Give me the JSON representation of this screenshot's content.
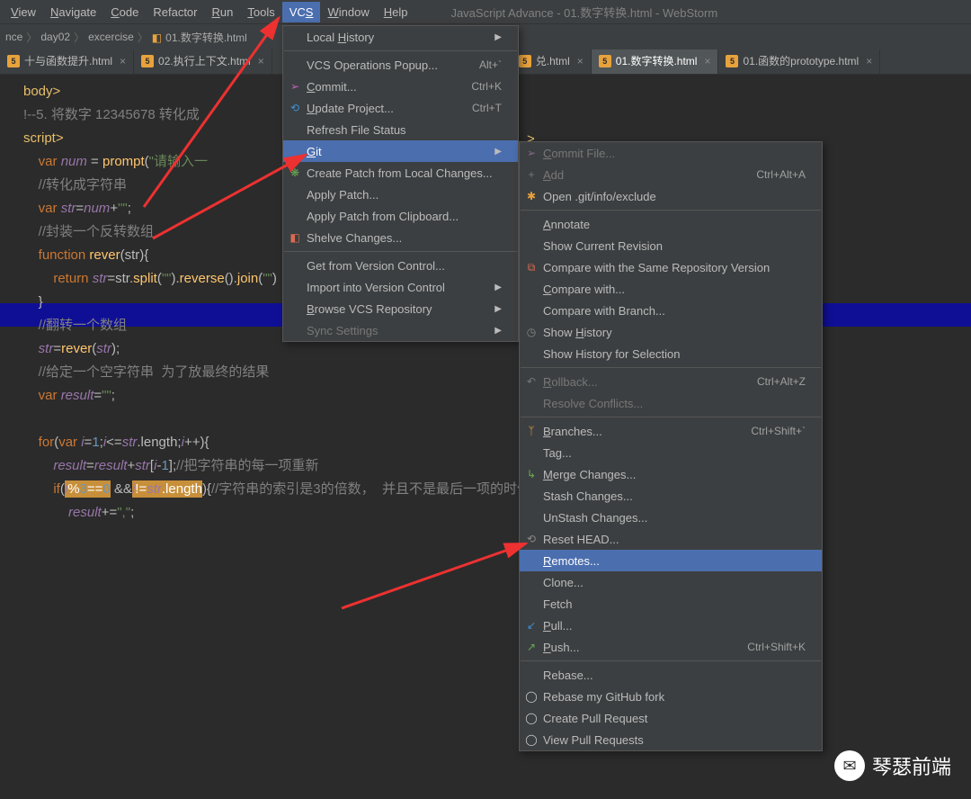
{
  "menubar": {
    "items": [
      "View",
      "Navigate",
      "Code",
      "Refactor",
      "Run",
      "Tools",
      "VCS",
      "Window",
      "Help"
    ],
    "underlines": [
      "V",
      "N",
      "C",
      "",
      "R",
      "T",
      "S",
      "W",
      "H"
    ],
    "title": "JavaScript Advance - 01.数字转换.html - WebStorm"
  },
  "breadcrumb": {
    "items": [
      "nce",
      "day02",
      "excercise",
      "01.数字转换.html"
    ],
    "last_is_file": true
  },
  "tabs": [
    {
      "label": "十与函数提升.html",
      "active": false
    },
    {
      "label": "02.执行上下文.html",
      "active": false
    },
    {
      "label": "兑.html",
      "active": false,
      "truncated": true
    },
    {
      "label": "01.数字转换.html",
      "active": true
    },
    {
      "label": "01.函数的prototype.html",
      "active": false
    }
  ],
  "code_html": "<span class='c-tag'>body&gt;</span>\n<span class='c-cmt'>!--5. 将数字 12345678 转化成</span>\n<span class='c-tag'>script&gt;</span>\n    <span class='c-kw'>var</span> <span class='c-id'>num</span> = <span class='c-fn'>prompt</span>(<span class='c-str'>\"请输入一</span>\n    <span class='c-cmt'>//转化成字符串</span>\n    <span class='c-kw'>var</span> <span class='c-id'>str</span>=<span class='c-id'>num</span>+<span class='c-str'>\"\"</span>;\n    <span class='c-cmt'>//封装一个反转数组</span>\n    <span class='c-kw'>function</span> <span class='c-fn'>rever</span>(str){\n        <span class='c-kw'>return</span> <span class='c-id'>str</span>=str.<span class='c-fn'>split</span>(<span class='c-str'>\"\"</span>).<span class='c-fn'>reverse</span>().<span class='c-fn'>join</span>(<span class='c-str'>\"\"</span>)\n    }\n    <span class='c-cmt'>//翻转一个数组</span>\n    <span class='c-id'>str</span>=<span class='c-fn'>rever</span>(<span class='c-id'>str</span>);\n    <span class='c-cmt'>//给定一个空字符串  为了放最终的结果</span>\n    <span class='c-kw'>var</span> <span class='c-id'>result</span>=<span class='c-str'>\"\"</span>;\n\n    <span class='c-kw'>for</span>(<span class='c-kw'>var</span> <span class='c-id'>i</span>=<span class='c-num'>1</span>;<span class='c-id'>i</span>&lt;=<span class='c-id'>str</span>.length;<span class='c-id'>i</span>++){\n        <span class='c-id'>result</span>=<span class='c-id'>result</span>+<span class='c-id'>str</span>[<span class='c-id'>i</span>-<span class='c-num'>1</span>];<span class='c-cmt'>//把字符串的每一项重新</span>\n        <span class='c-kw'>if</span>(<span class='c-hi'><span class='c-id'>i</span>%<span class='c-num'>3</span>==<span class='c-num'>0</span></span> &amp;&amp;<span class='c-hi'><span class='c-id'>i</span>!=<span class='c-id'>str</span>.length</span>){<span class='c-cmt'>//字符串的索引是3的倍数，  并且不是最后一项的时候添加</span>\n            <span class='c-id'>result</span>+=<span class='c-str'>\",\"</span>;",
  "vcs_menu": [
    {
      "type": "item",
      "label": "Local History",
      "arrow": true,
      "u": "H"
    },
    {
      "type": "sep"
    },
    {
      "type": "item",
      "label": "VCS Operations Popup...",
      "shortcut": "Alt+`"
    },
    {
      "type": "item",
      "label": "Commit...",
      "shortcut": "Ctrl+K",
      "u": "C",
      "glyph": "➢",
      "glyphColor": "#c161c1"
    },
    {
      "type": "item",
      "label": "Update Project...",
      "shortcut": "Ctrl+T",
      "u": "U",
      "glyph": "⟲",
      "glyphColor": "#3a8fd6"
    },
    {
      "type": "item",
      "label": "Refresh File Status"
    },
    {
      "type": "item",
      "label": "Git",
      "sel": true,
      "arrow": true,
      "u": "G"
    },
    {
      "type": "item",
      "label": "Create Patch from Local Changes...",
      "glyph": "❋",
      "glyphColor": "#6aab51"
    },
    {
      "type": "item",
      "label": "Apply Patch..."
    },
    {
      "type": "item",
      "label": "Apply Patch from Clipboard..."
    },
    {
      "type": "item",
      "label": "Shelve Changes...",
      "glyph": "◧",
      "glyphColor": "#d66b54"
    },
    {
      "type": "sep"
    },
    {
      "type": "item",
      "label": "Get from Version Control..."
    },
    {
      "type": "item",
      "label": "Import into Version Control",
      "arrow": true
    },
    {
      "type": "item",
      "label": "Browse VCS Repository",
      "arrow": true,
      "u": "B"
    },
    {
      "type": "item",
      "label": "Sync Settings",
      "arrow": true,
      "dis": true
    }
  ],
  "git_menu": [
    {
      "type": "item",
      "label": "Commit File...",
      "dis": true,
      "glyph": "➢",
      "glyphColor": "#8a6a8a",
      "u": "C"
    },
    {
      "type": "item",
      "label": "Add",
      "shortcut": "Ctrl+Alt+A",
      "glyph": "+",
      "glyphColor": "#777",
      "dis": true,
      "u": "A"
    },
    {
      "type": "item",
      "label": "Open .git/info/exclude",
      "glyph": "✱",
      "glyphColor": "#e8a23c"
    },
    {
      "type": "sep"
    },
    {
      "type": "item",
      "label": "Annotate",
      "u": "A"
    },
    {
      "type": "item",
      "label": "Show Current Revision"
    },
    {
      "type": "item",
      "label": "Compare with the Same Repository Version",
      "glyph": "⧉",
      "glyphColor": "#d66b54"
    },
    {
      "type": "item",
      "label": "Compare with...",
      "u": "C"
    },
    {
      "type": "item",
      "label": "Compare with Branch..."
    },
    {
      "type": "item",
      "label": "Show History",
      "glyph": "◷",
      "glyphColor": "#888",
      "u": "H"
    },
    {
      "type": "item",
      "label": "Show History for Selection"
    },
    {
      "type": "sep"
    },
    {
      "type": "item",
      "label": "Rollback...",
      "shortcut": "Ctrl+Alt+Z",
      "dis": true,
      "glyph": "↶",
      "glyphColor": "#777",
      "u": "R"
    },
    {
      "type": "item",
      "label": "Resolve Conflicts...",
      "dis": true
    },
    {
      "type": "sep"
    },
    {
      "type": "item",
      "label": "Branches...",
      "shortcut": "Ctrl+Shift+`",
      "glyph": "ᛉ",
      "glyphColor": "#e8a23c",
      "u": "B"
    },
    {
      "type": "item",
      "label": "Tag..."
    },
    {
      "type": "item",
      "label": "Merge Changes...",
      "glyph": "↳",
      "glyphColor": "#6aab51",
      "u": "M"
    },
    {
      "type": "item",
      "label": "Stash Changes..."
    },
    {
      "type": "item",
      "label": "UnStash Changes..."
    },
    {
      "type": "item",
      "label": "Reset HEAD...",
      "glyph": "⟲",
      "glyphColor": "#888"
    },
    {
      "type": "item",
      "label": "Remotes...",
      "sel": true,
      "u": "R"
    },
    {
      "type": "item",
      "label": "Clone..."
    },
    {
      "type": "item",
      "label": "Fetch"
    },
    {
      "type": "item",
      "label": "Pull...",
      "glyph": "↙",
      "glyphColor": "#3a8fd6",
      "u": "P"
    },
    {
      "type": "item",
      "label": "Push...",
      "shortcut": "Ctrl+Shift+K",
      "glyph": "↗",
      "glyphColor": "#6aab51",
      "u": "P"
    },
    {
      "type": "sep"
    },
    {
      "type": "item",
      "label": "Rebase..."
    },
    {
      "type": "item",
      "label": "Rebase my GitHub fork",
      "glyph": "◯",
      "glyphColor": "#ccc"
    },
    {
      "type": "item",
      "label": "Create Pull Request",
      "glyph": "◯",
      "glyphColor": "#ccc"
    },
    {
      "type": "item",
      "label": "View Pull Requests",
      "glyph": "◯",
      "glyphColor": "#ccc"
    }
  ],
  "watermark": {
    "text": "琴瑟前端"
  }
}
